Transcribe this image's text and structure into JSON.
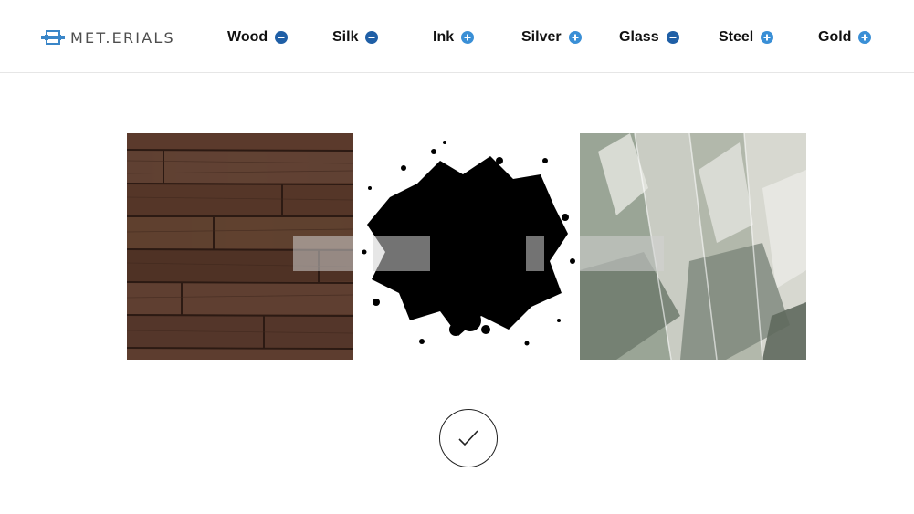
{
  "brand": {
    "name": "MET.ERIALS",
    "accent_color": "#3a86c8"
  },
  "nav": [
    {
      "label": "Wood",
      "icon": "minus-circle-icon",
      "state": "selected"
    },
    {
      "label": "Silk",
      "icon": "minus-circle-icon",
      "state": "selected"
    },
    {
      "label": "Ink",
      "icon": "plus-circle-icon",
      "state": "unselected"
    },
    {
      "label": "Silver",
      "icon": "plus-circle-icon",
      "state": "unselected"
    },
    {
      "label": "Glass",
      "icon": "minus-circle-icon",
      "state": "selected"
    },
    {
      "label": "Steel",
      "icon": "plus-circle-icon",
      "state": "unselected"
    },
    {
      "label": "Gold",
      "icon": "plus-circle-icon",
      "state": "unselected"
    }
  ],
  "colors": {
    "minus_icon": "#1f5fa6",
    "plus_icon": "#3a8fd6",
    "header_border": "#e6e6e6"
  },
  "tiles": [
    {
      "material": "wood",
      "image": "wood-planks-image"
    },
    {
      "material": "ink",
      "image": "ink-splatter-image"
    },
    {
      "material": "glass",
      "image": "crystal-glass-image"
    }
  ],
  "confirm": {
    "icon": "checkmark-icon"
  }
}
